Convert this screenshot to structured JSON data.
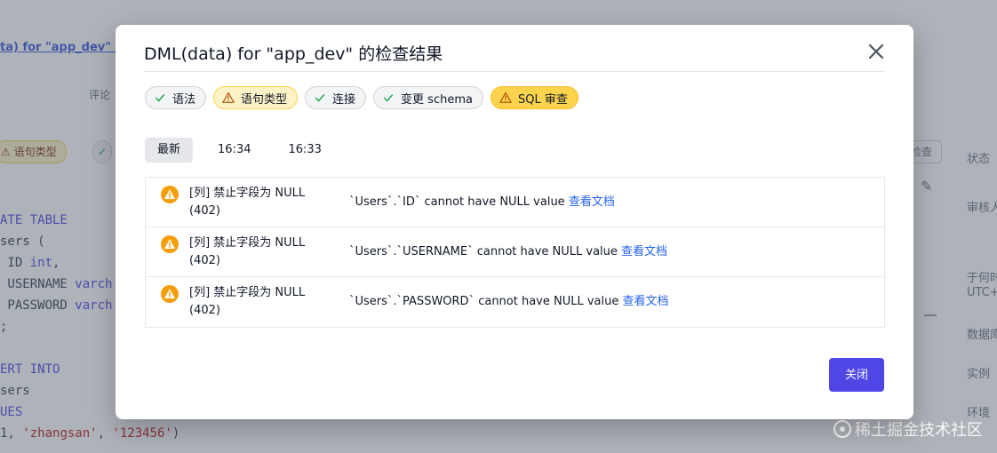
{
  "background": {
    "link_text": "ta) for \"app_dev\" (",
    "comment_label": "评论",
    "pill_warn_label": "语句类型",
    "right_button_label": "检查",
    "side_labels": [
      "状态",
      "审核人",
      "于何时",
      "UTC+",
      "数据库",
      "实例",
      "环境"
    ],
    "code_lines": [
      [
        {
          "t": "ATE TABLE",
          "c": "kw"
        }
      ],
      [
        {
          "t": "sers (",
          "c": ""
        }
      ],
      [
        {
          "t": " ID ",
          "c": ""
        },
        {
          "t": "int",
          "c": "ty"
        },
        {
          "t": ",",
          "c": ""
        }
      ],
      [
        {
          "t": " USERNAME ",
          "c": ""
        },
        {
          "t": "varch",
          "c": "ty"
        }
      ],
      [
        {
          "t": " PASSWORD ",
          "c": ""
        },
        {
          "t": "varch",
          "c": "ty"
        }
      ],
      [
        {
          "t": ";",
          "c": ""
        }
      ],
      [
        {
          "t": "",
          "c": ""
        }
      ],
      [
        {
          "t": "ERT INTO",
          "c": "kw"
        }
      ],
      [
        {
          "t": "sers",
          "c": ""
        }
      ],
      [
        {
          "t": "UES",
          "c": "kw"
        }
      ],
      [
        {
          "t": "1, ",
          "c": ""
        },
        {
          "t": "'zhangsan'",
          "c": "str"
        },
        {
          "t": ", ",
          "c": ""
        },
        {
          "t": "'123456'",
          "c": "str"
        },
        {
          "t": ")",
          "c": ""
        }
      ]
    ],
    "watermark": "稀土掘金技术社区"
  },
  "modal": {
    "title": "DML(data) for \"app_dev\" 的检查结果",
    "close_label": "close",
    "checks": [
      {
        "label": "语法",
        "status": "ok",
        "icon": "check-icon"
      },
      {
        "label": "语句类型",
        "status": "warn",
        "icon": "warning-icon"
      },
      {
        "label": "连接",
        "status": "ok",
        "icon": "check-icon"
      },
      {
        "label": "变更 schema",
        "status": "ok",
        "icon": "check-icon"
      },
      {
        "label": "SQL 审查",
        "status": "warn-strong",
        "icon": "warning-icon"
      }
    ],
    "tabs": [
      {
        "label": "最新",
        "active": true
      },
      {
        "label": "16:34",
        "active": false
      },
      {
        "label": "16:33",
        "active": false
      }
    ],
    "results": [
      {
        "title": "[列] 禁止字段为 NULL (402)",
        "message": "`Users`.`ID` cannot have NULL value ",
        "link": "查看文档",
        "icon": "warning-circle-icon"
      },
      {
        "title": "[列] 禁止字段为 NULL (402)",
        "message": "`Users`.`USERNAME` cannot have NULL value ",
        "link": "查看文档",
        "icon": "warning-circle-icon"
      },
      {
        "title": "[列] 禁止字段为 NULL (402)",
        "message": "`Users`.`PASSWORD` cannot have NULL value ",
        "link": "查看文档",
        "icon": "warning-circle-icon"
      }
    ],
    "close_button_label": "关闭"
  },
  "colors": {
    "primary": "#4f46e5",
    "warning": "#f59e0b",
    "ok": "#16a34a",
    "link": "#2563eb"
  }
}
